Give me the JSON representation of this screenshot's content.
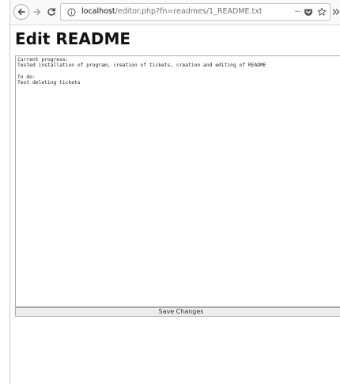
{
  "browser": {
    "url_host": "localhost",
    "url_path": "/editor.php?fn=readmes/1_README.txt",
    "actions": {
      "page_actions_label": "···"
    },
    "icons": {
      "back": "back-arrow-icon",
      "forward": "forward-arrow-icon",
      "reload": "reload-icon",
      "info": "info-icon",
      "pocket": "pocket-icon",
      "bookmark": "star-icon",
      "overflow": "chevron-double-right-icon"
    }
  },
  "page": {
    "title": "Edit README",
    "editor_content": "Current progress:\nTested installation of program, creation of tickets, creation and editing of README\n\nTo do:\nTest deleting tickets",
    "save_label": "Save Changes"
  }
}
